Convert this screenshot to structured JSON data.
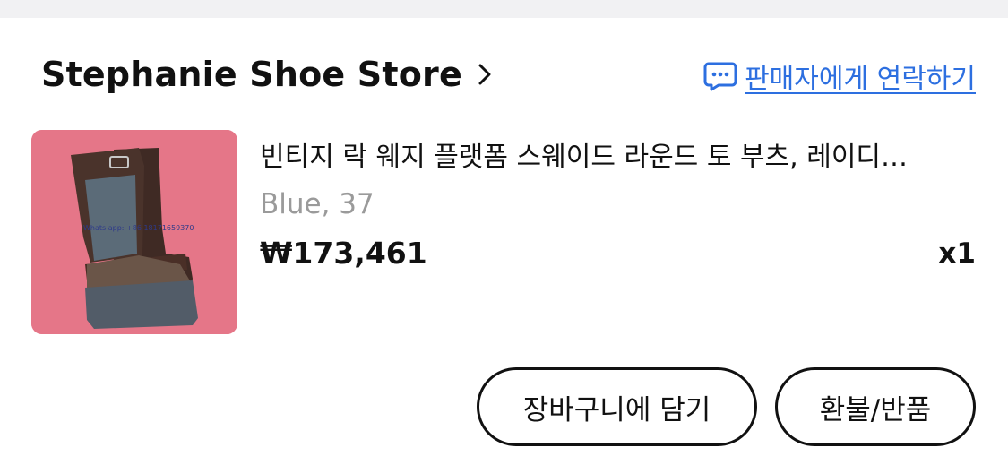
{
  "store": {
    "name": "Stephanie Shoe Store",
    "contact_label": "판매자에게 연락하기"
  },
  "product": {
    "title": "빈티지 락 웨지 플랫폼 스웨이드 라운드 토 부츠, 레이디…",
    "option": "Blue, 37",
    "price": "₩173,461",
    "quantity": "x1",
    "image_watermark": "Whats app: +86 18171659370"
  },
  "actions": {
    "add_to_cart": "장바구니에 담기",
    "refund_return": "환불/반품"
  },
  "colors": {
    "accent_link": "#2d6fe0",
    "image_background": "#e57688",
    "muted_text": "#9a9a9a"
  },
  "icons": {
    "store_chevron": "chevron-right-icon",
    "contact": "chat-bubble-icon"
  }
}
